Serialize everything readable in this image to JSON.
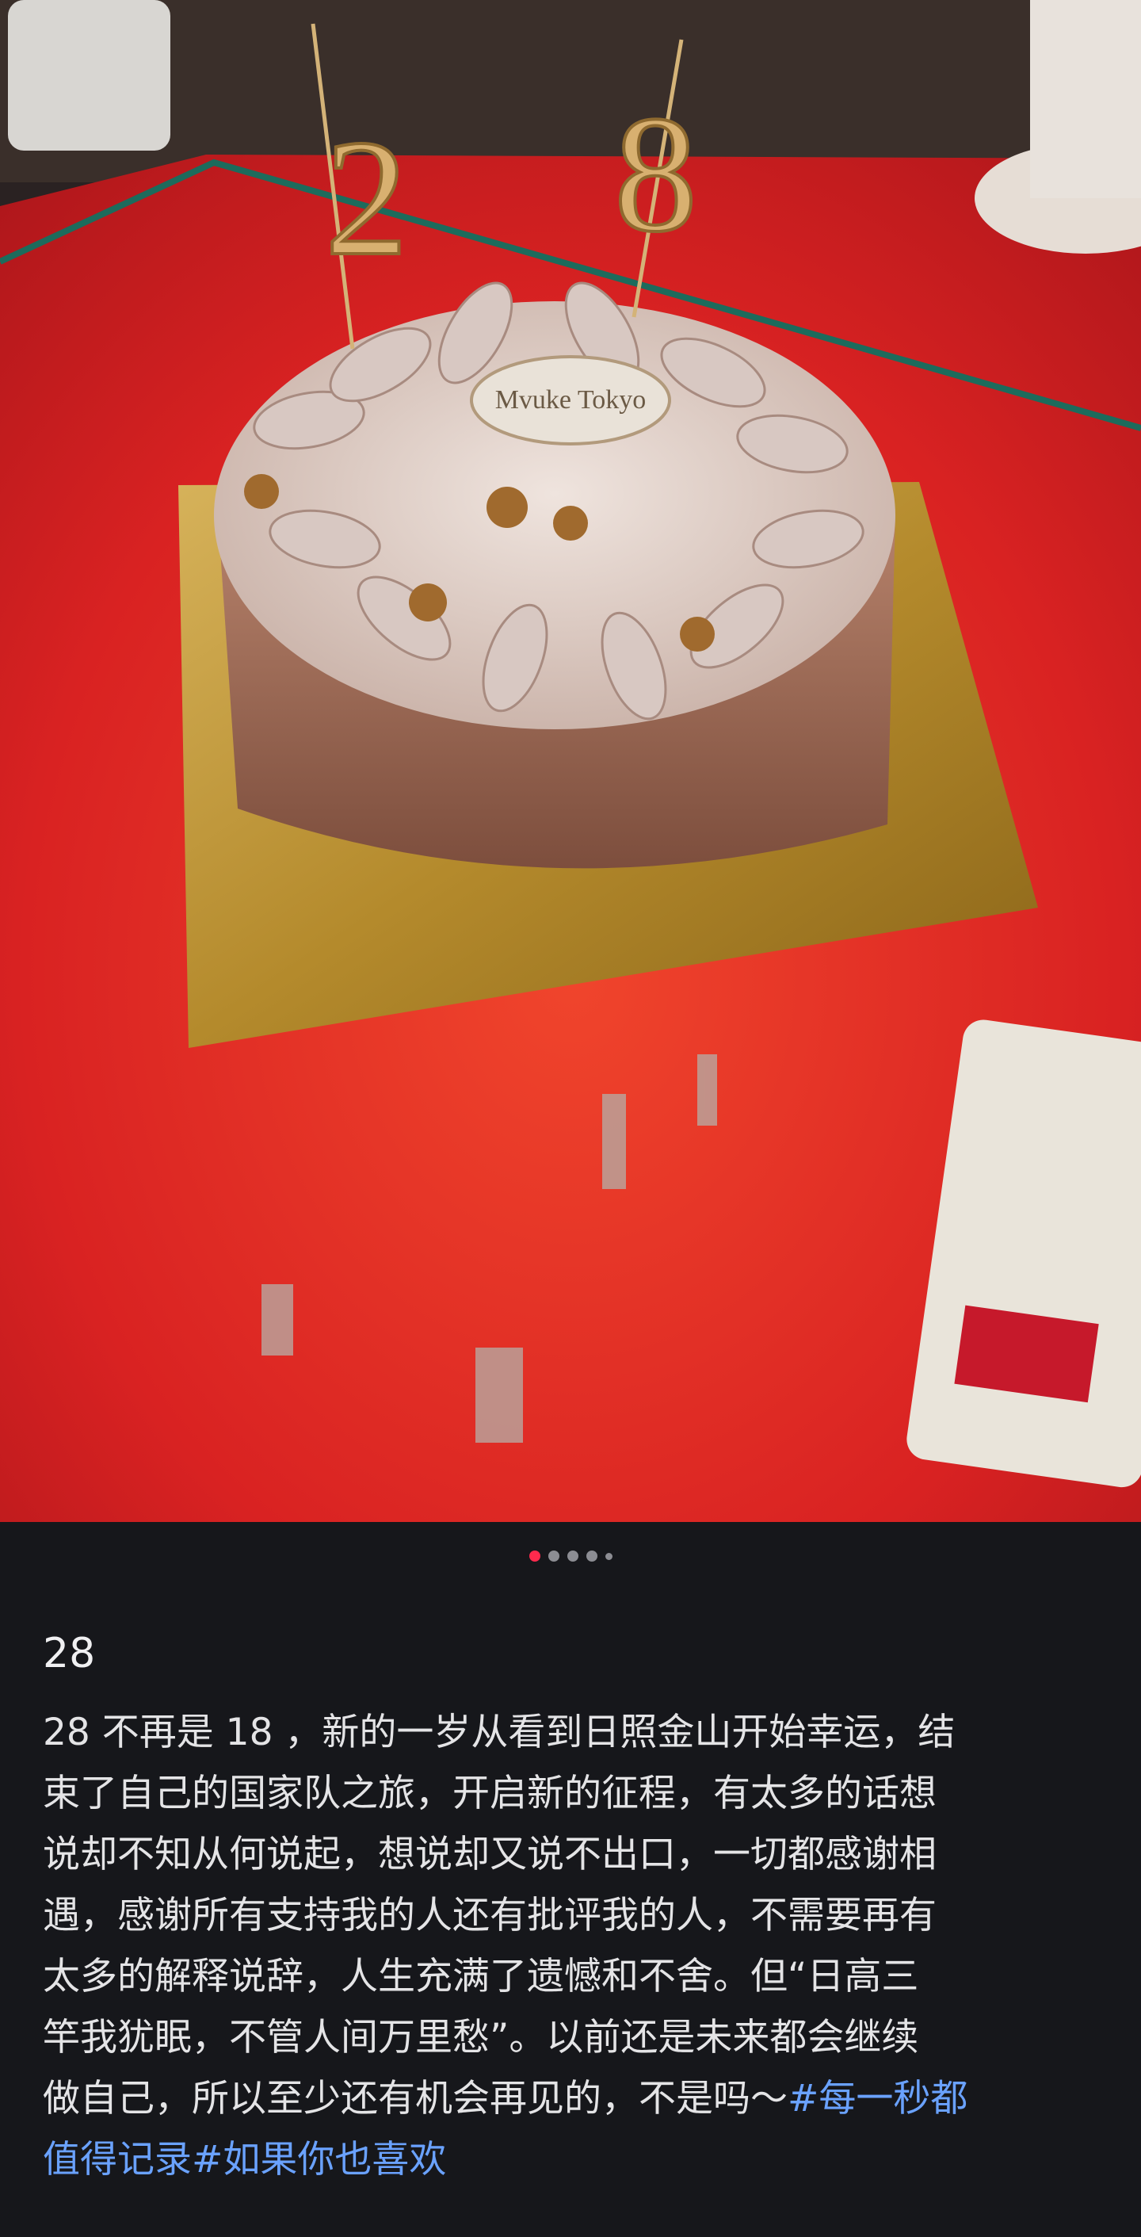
{
  "post": {
    "title": "28",
    "body_lines": [
      "28 不再是 18 ，新的一岁从看到日照金山开始幸运，结",
      "束了自己的国家队之旅，开启新的征程，有太多的话想",
      "说却不知从何说起，想说却又说不出口，一切都感谢相",
      "遇，感谢所有支持我的人还有批评我的人，不需要再有",
      "太多的解释说辞，人生充满了遗憾和不舍。但“日高三",
      "竿我犹眠，不管人间万里愁”。以前还是未来都会继续",
      "做自己，所以至少还有机会再见的，不是吗～"
    ],
    "tag1": "#每一秒都",
    "tag1_cont": "值得记录",
    "tag2": "#如果你也喜欢"
  },
  "photo": {
    "cake_plaque_text": "Mvuke Tokyo",
    "candle_1": "2",
    "candle_2": "8"
  },
  "carousel": {
    "count": 5,
    "active_index": 0
  },
  "colors": {
    "accent": "#ff2a4d",
    "hashtag": "#6aa2ff",
    "background": "#16171b"
  }
}
